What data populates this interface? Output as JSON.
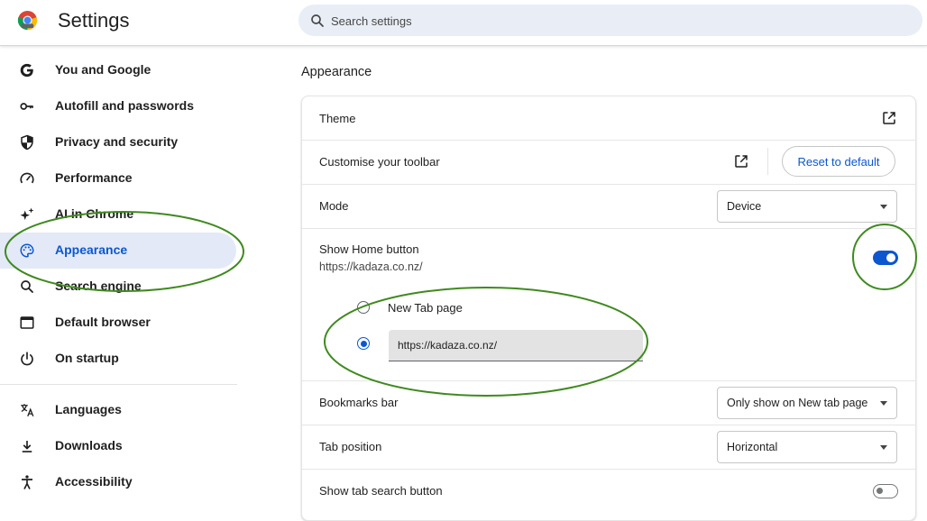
{
  "header": {
    "title": "Settings",
    "search_placeholder": "Search settings"
  },
  "sidebar": {
    "items": [
      {
        "label": "You and Google",
        "icon": "google-g-icon"
      },
      {
        "label": "Autofill and passwords",
        "icon": "key-icon"
      },
      {
        "label": "Privacy and security",
        "icon": "shield-icon"
      },
      {
        "label": "Performance",
        "icon": "speedometer-icon"
      },
      {
        "label": "AI in Chrome",
        "icon": "sparkle-icon"
      },
      {
        "label": "Appearance",
        "icon": "palette-icon",
        "active": true
      },
      {
        "label": "Search engine",
        "icon": "search-icon"
      },
      {
        "label": "Default browser",
        "icon": "browser-window-icon"
      },
      {
        "label": "On startup",
        "icon": "power-icon"
      },
      {
        "label": "Languages",
        "icon": "translate-icon"
      },
      {
        "label": "Downloads",
        "icon": "download-icon"
      },
      {
        "label": "Accessibility",
        "icon": "accessibility-icon"
      }
    ]
  },
  "main": {
    "section_title": "Appearance",
    "theme": {
      "label": "Theme"
    },
    "toolbar": {
      "label": "Customise your toolbar",
      "reset_label": "Reset to default"
    },
    "mode": {
      "label": "Mode",
      "value": "Device"
    },
    "home_button": {
      "label": "Show Home button",
      "sublabel": "https://kadaza.co.nz/",
      "enabled": true,
      "option_new_tab": "New Tab page",
      "custom_url": "https://kadaza.co.nz/",
      "selected": "custom"
    },
    "bookmarks_bar": {
      "label": "Bookmarks bar",
      "value": "Only show on New tab page"
    },
    "tab_position": {
      "label": "Tab position",
      "value": "Horizontal"
    },
    "tab_search": {
      "label": "Show tab search button",
      "enabled": false
    }
  },
  "colors": {
    "accent": "#0b57d0",
    "active_nav_bg": "#e3e9f6",
    "annotation": "#3f8a1f"
  }
}
